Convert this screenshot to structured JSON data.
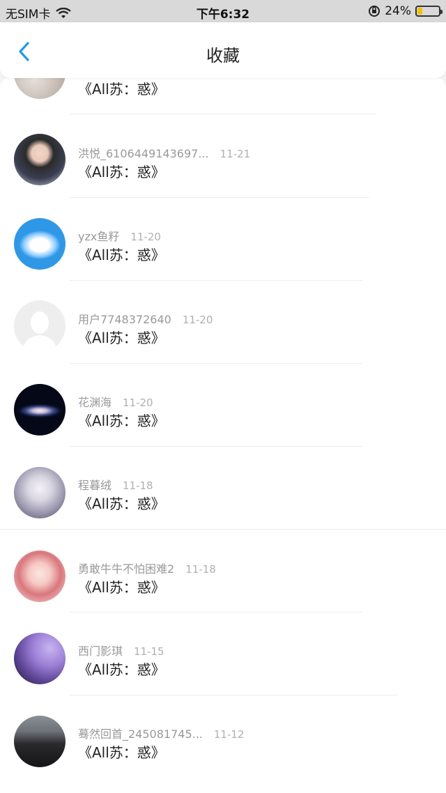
{
  "status_bar": {
    "carrier": "无SIM卡",
    "time": "下午6:32",
    "battery": "24%",
    "battery_level": 0.24,
    "icons": [
      "wifi-icon",
      "orientation-lock-icon",
      "battery-icon"
    ]
  },
  "nav": {
    "title": "收藏",
    "back_icon": "chevron-left-icon",
    "accent_color": "#1e9be8"
  },
  "items": [
    {
      "user": "",
      "date": "",
      "title": "《All苏：惑》",
      "avatar": "fox-plush"
    },
    {
      "user": "洪悦_6106449143697...",
      "date": "11-21",
      "title": "《All苏：惑》",
      "avatar": "girl-photo"
    },
    {
      "user": "yzx鱼籽",
      "date": "11-20",
      "title": "《All苏：惑》",
      "avatar": "blue-sky-cloud"
    },
    {
      "user": "用户7748372640",
      "date": "11-20",
      "title": "《All苏：惑》",
      "avatar": "default-user"
    },
    {
      "user": "花渊海",
      "date": "11-20",
      "title": "《All苏：惑》",
      "avatar": "galaxy"
    },
    {
      "user": "程暮绒",
      "date": "11-18",
      "title": "《All苏：惑》",
      "avatar": "anime-silver-hair"
    },
    {
      "user": "勇敢牛牛不怕困难2",
      "date": "11-18",
      "title": "《All苏：惑》",
      "avatar": "anime-pink-girl"
    },
    {
      "user": "西门影琪",
      "date": "11-15",
      "title": "《All苏：惑》",
      "avatar": "purple-silhouette"
    },
    {
      "user": "蓦然回首_245081745...",
      "date": "11-12",
      "title": "《All苏：惑》",
      "avatar": "hooded-figure"
    }
  ]
}
